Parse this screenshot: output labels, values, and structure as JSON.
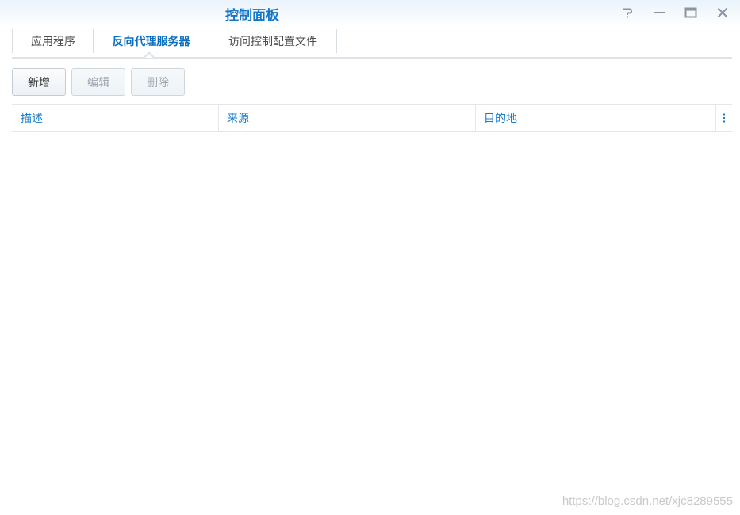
{
  "window": {
    "title": "控制面板",
    "controls": {
      "help_icon": "help-icon",
      "minimize_icon": "minimize-icon",
      "maximize_icon": "maximize-icon",
      "close_icon": "close-icon"
    }
  },
  "tabs": [
    {
      "label": "应用程序",
      "active": false
    },
    {
      "label": "反向代理服务器",
      "active": true
    },
    {
      "label": "访问控制配置文件",
      "active": false
    }
  ],
  "toolbar": {
    "create_label": "新增",
    "edit_label": "编辑",
    "delete_label": "删除"
  },
  "grid": {
    "columns": [
      "描述",
      "来源",
      "目的地"
    ],
    "rows": []
  },
  "watermark": "https://blog.csdn.net/xjc8289555",
  "colors": {
    "accent": "#1476c7",
    "column_header": "#1a7ccc",
    "disabled_text": "#9aa4ad"
  }
}
